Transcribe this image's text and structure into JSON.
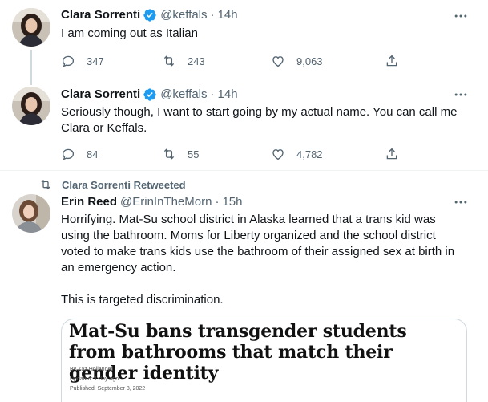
{
  "tweets": [
    {
      "name": "Clara Sorrenti",
      "handle": "@keffals",
      "sep": "·",
      "time": "14h",
      "text": "I am coming out as Italian",
      "replies": "347",
      "retweets": "243",
      "likes": "9,063"
    },
    {
      "name": "Clara Sorrenti",
      "handle": "@keffals",
      "sep": "·",
      "time": "14h",
      "text": "Seriously though, I want to start going by my actual name. You can call me Clara or Keffals.",
      "replies": "84",
      "retweets": "55",
      "likes": "4,782"
    }
  ],
  "retweet": {
    "label": "Clara Sorrenti Retweeted",
    "name": "Erin Reed",
    "handle": "@ErinInTheMorn",
    "sep": "·",
    "time": "15h",
    "text": "Horrifying. Mat-Su school district in Alaska learned that a trans kid was using the bathroom. Moms for Liberty organized and the school district voted to make trans kids use the bathroom of their assigned sex at birth in an emergency action.\n\nThis is targeted discrimination.",
    "card": {
      "headline": "Mat-Su bans transgender students from bathrooms that match their gender identity",
      "byline": "By Zaz Hollander",
      "updated": "Updated: 1 day ago",
      "published": "Published: September 8, 2022"
    }
  },
  "icons": {
    "verified": "verified-badge-icon",
    "more": "more-horizontal-icon",
    "reply": "reply-icon",
    "retweet": "retweet-icon",
    "like": "heart-icon",
    "share": "share-icon"
  },
  "colors": {
    "verified": "#1d9bf0",
    "secondary_text": "#536471",
    "thread_line": "#cfd9de"
  }
}
